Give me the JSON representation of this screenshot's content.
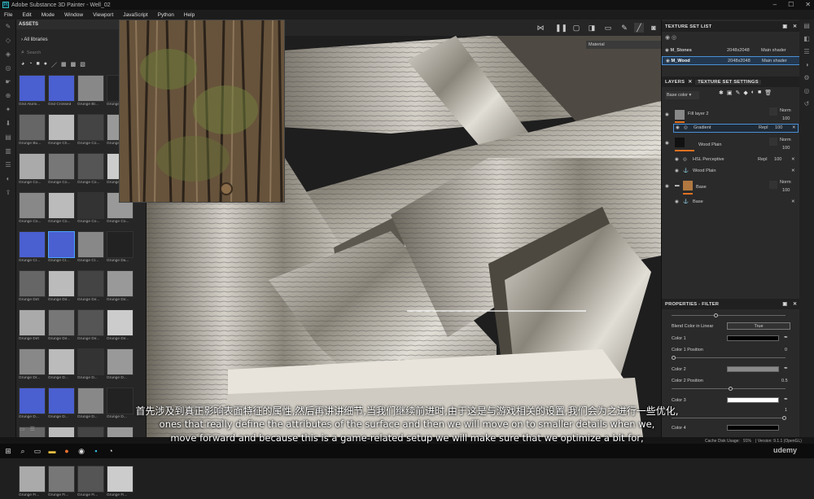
{
  "window": {
    "title": "Adobe Substance 3D Painter - Well_02"
  },
  "menu": [
    "File",
    "Edit",
    "Mode",
    "Window",
    "Viewport",
    "JavaScript",
    "Python",
    "Help"
  ],
  "assets": {
    "title": "ASSETS",
    "library": "All libraries",
    "search_placeholder": "Search",
    "tiles": [
      "Grid Alumi...",
      "Grid Crossed",
      "Grunge Br...",
      "Grunge Ru...",
      "Grunge Bu...",
      "Grunge Ch...",
      "Grunge Co...",
      "Grunge Co...",
      "Grunge Co...",
      "Grunge Co...",
      "Grunge Co...",
      "Grunge Co...",
      "Grunge Co...",
      "Grunge Co...",
      "Grunge Co...",
      "Grunge Co...",
      "Grunge Cr...",
      "Grunge Cr...",
      "Grunge Cr...",
      "Grunge Da...",
      "Grunge Dirt",
      "Grunge Dir...",
      "Grunge Dir...",
      "Grunge Dir...",
      "Grunge Dirt",
      "Grunge Dir...",
      "Grunge Dir...",
      "Grunge Dir...",
      "Grunge Dr...",
      "Grunge D...",
      "Grunge D...",
      "Grunge D...",
      "Grunge D...",
      "Grunge D...",
      "Grunge D...",
      "Grunge D...",
      "Grunge F...",
      "Grunge Fi...",
      "Grunge Fi...",
      "Grunge Fi...",
      "Grunge Fi...",
      "Grunge Fi...",
      "Grunge Fi...",
      "Grunge Fi..."
    ]
  },
  "viewport": {
    "material_label": "Material"
  },
  "texture_set_list": {
    "title": "TEXTURE SET LIST",
    "rows": [
      {
        "name": "M_Stones",
        "res": "2048x2048",
        "shader": "Main shader"
      },
      {
        "name": "M_Wood",
        "res": "2048x2048",
        "shader": "Main shader"
      }
    ]
  },
  "layers": {
    "tab": "LAYERS",
    "tab2": "TEXTURE SET SETTINGS",
    "channel": "Base color",
    "items": [
      {
        "name": "Fill layer 2",
        "blend": "Norm",
        "opacity": "100"
      },
      {
        "name": "Gradient",
        "blend": "Repl",
        "opacity": "100"
      },
      {
        "name": "Wood Plain",
        "blend": "Norm",
        "opacity": "100"
      },
      {
        "name": "HSL Perceptive",
        "blend": "Repl",
        "opacity": "100"
      },
      {
        "name": "Wood Plain"
      },
      {
        "name": "Base",
        "blend": "Norm",
        "opacity": "100"
      },
      {
        "name": "Base"
      }
    ]
  },
  "properties": {
    "title": "PROPERTIES - FILTER",
    "blend_linear_label": "Blend Color in Linear",
    "blend_linear_value": "True",
    "color1": "Color 1",
    "color1_pos": "Color 1 Position",
    "color1_pos_val": "0",
    "color2": "Color 2",
    "color2_pos": "Color 2 Position",
    "color2_pos_val": "0.5",
    "color3": "Color 3",
    "color3_val": "1",
    "color4": "Color 4",
    "colors": {
      "c1": "#000000",
      "c2": "#8a8a8a",
      "c3": "#ffffff",
      "c4": "#000000"
    }
  },
  "status": {
    "cache": "Cache Disk Usage:",
    "cache_val": "91%",
    "version": "| Version: 9.1.1 (OpenGL)"
  },
  "subtitles": {
    "zh": "首先涉及到真正影响表面特征的属性,然后再讲讲细节,当我们继续前进时,由于这是与游戏相关的设置,我们会为之进行一些优化,",
    "en1": "ones that really define the attributes of the surface and then we will move on to smaller details when we,",
    "en2": "move forward and because this is a game-related setup we will make sure that we optimize a bit for,"
  },
  "watermark": "udemy"
}
